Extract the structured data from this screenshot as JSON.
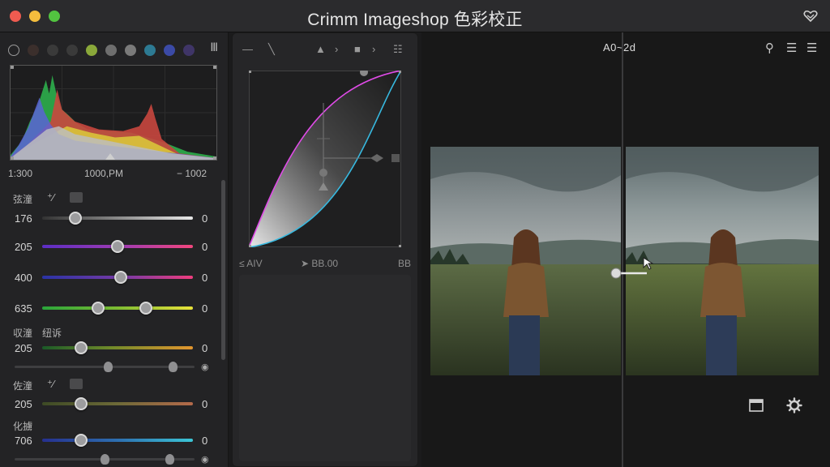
{
  "window": {
    "title": "Crimm Imageshop 色彩校正"
  },
  "colors": {
    "accent_magenta": "#e04be8",
    "accent_cyan": "#37b9e0",
    "panel": "#232325"
  },
  "swatches": [
    "#1b1b1b",
    "#3b2f2c",
    "#3a3a3a",
    "#3a3a3a",
    "#8aa83a",
    "#6e6e6e",
    "#7a7a7a",
    "#2d7a93",
    "#3b4aa6",
    "#3f3567"
  ],
  "histogram": {
    "tool_icon": "Ⅲ",
    "labels": {
      "left": "1:300",
      "mid": "1000,PM",
      "right": "− 1002"
    }
  },
  "section1": {
    "label": "弦潼",
    "tool_glyph": "⁺⁄"
  },
  "sliders1": [
    {
      "num": "176",
      "value": 0,
      "pos": 0.22,
      "gradient": "linear-gradient(90deg,#333 0%,#777 40%,#e7e7e7 100%)"
    },
    {
      "num": "205",
      "value": 0,
      "pos": 0.5,
      "gradient": "linear-gradient(90deg,#5b2ec5 0%,#a33cb0 55%,#f2467d 100%)"
    },
    {
      "num": "400",
      "value": 0,
      "pos": 0.52,
      "gradient": "linear-gradient(90deg,#2a33a5 0%,#7a3aa5 55%,#ef3d7e 100%)"
    },
    {
      "num": "635",
      "value": 0,
      "pos": 0.37,
      "pos2": 0.69,
      "gradient": "linear-gradient(90deg,#2aa53a 0%,#7dbb32 50%,#e8e23a 100%)"
    }
  ],
  "section2": {
    "label_a": "収潼",
    "label_b": "纽诉"
  },
  "sliders2": [
    {
      "num": "205",
      "value": 0,
      "pos": 0.26,
      "gradient": "linear-gradient(90deg,#1b5a28 0%,#6f8a2a 45%,#e3962e 100%)"
    }
  ],
  "mini1": {
    "pos_a": 0.52,
    "pos_b": 0.88
  },
  "section3": {
    "label": "佐潼",
    "tool_glyph": "⁺⁄"
  },
  "sliders3": [
    {
      "num": "205",
      "value": 0,
      "pos": 0.26,
      "gradient": "linear-gradient(90deg,#3d4a25 0%,#6d6a38 50%,#b46a4a 100%)"
    }
  ],
  "section4": {
    "label": "化擄"
  },
  "sliders4": [
    {
      "num": "706",
      "value": 0,
      "pos": 0.26,
      "gradient": "linear-gradient(90deg,#26308f 0%,#2d6fb0 50%,#3cc6d6 100%)"
    }
  ],
  "mini2": {
    "pos_a": 0.5,
    "pos_b": 0.86
  },
  "curves": {
    "top_icons": [
      "—",
      "╲",
      "▲",
      "›",
      "■",
      "›",
      "☷"
    ],
    "labels": {
      "left": "≤ AIV",
      "mid": "➤ BB.00",
      "right": "BB"
    }
  },
  "preview": {
    "zoom_label": "A0~2d",
    "right_icons": [
      "⚲",
      "☰",
      "☰"
    ],
    "bottom_icons": [
      "window-icon",
      "gear-icon"
    ]
  }
}
